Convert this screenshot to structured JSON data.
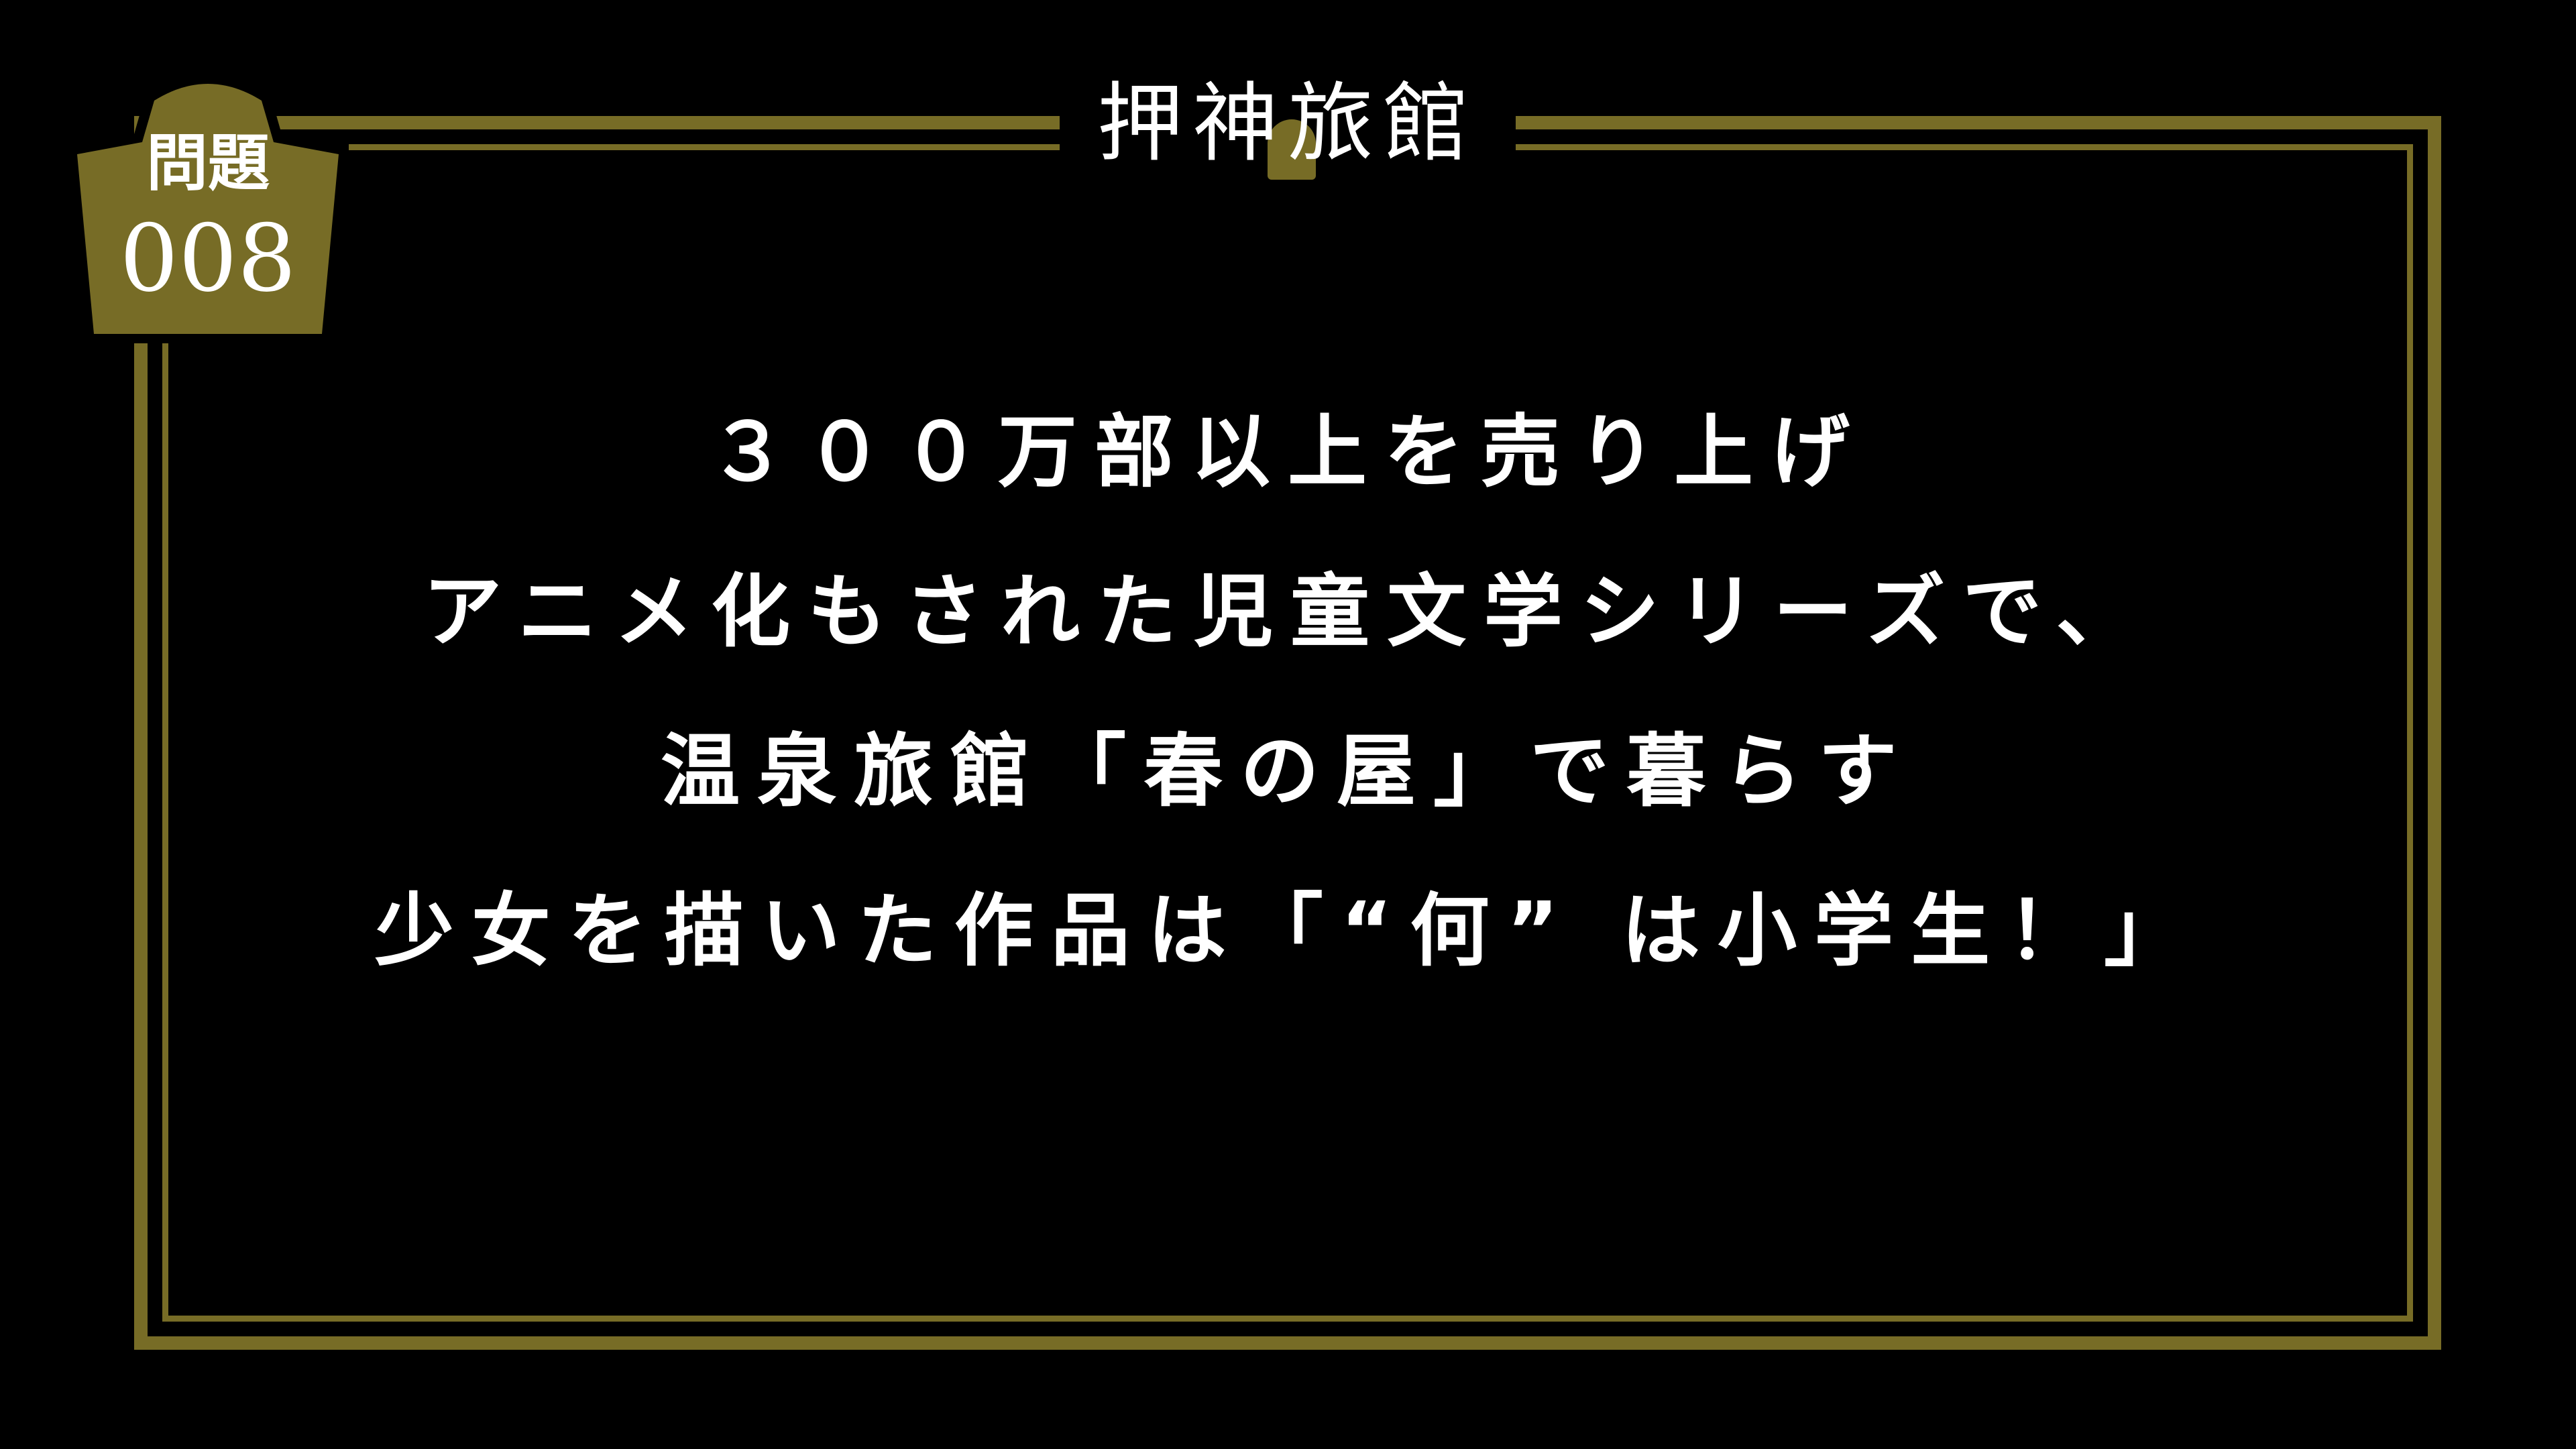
{
  "brand": {
    "logo_text": "押神旅館",
    "accent_color": "#776c26",
    "background_color": "#000000",
    "text_color": "#ffffff"
  },
  "badge": {
    "label": "問題",
    "number": "008"
  },
  "question": {
    "lines": [
      "３００万部以上を売り上げ",
      "アニメ化もされた児童文学シリーズで、",
      "温泉旅館「春の屋」で暮らす",
      "少女を描いた作品は「“何” は小学生！」"
    ]
  }
}
